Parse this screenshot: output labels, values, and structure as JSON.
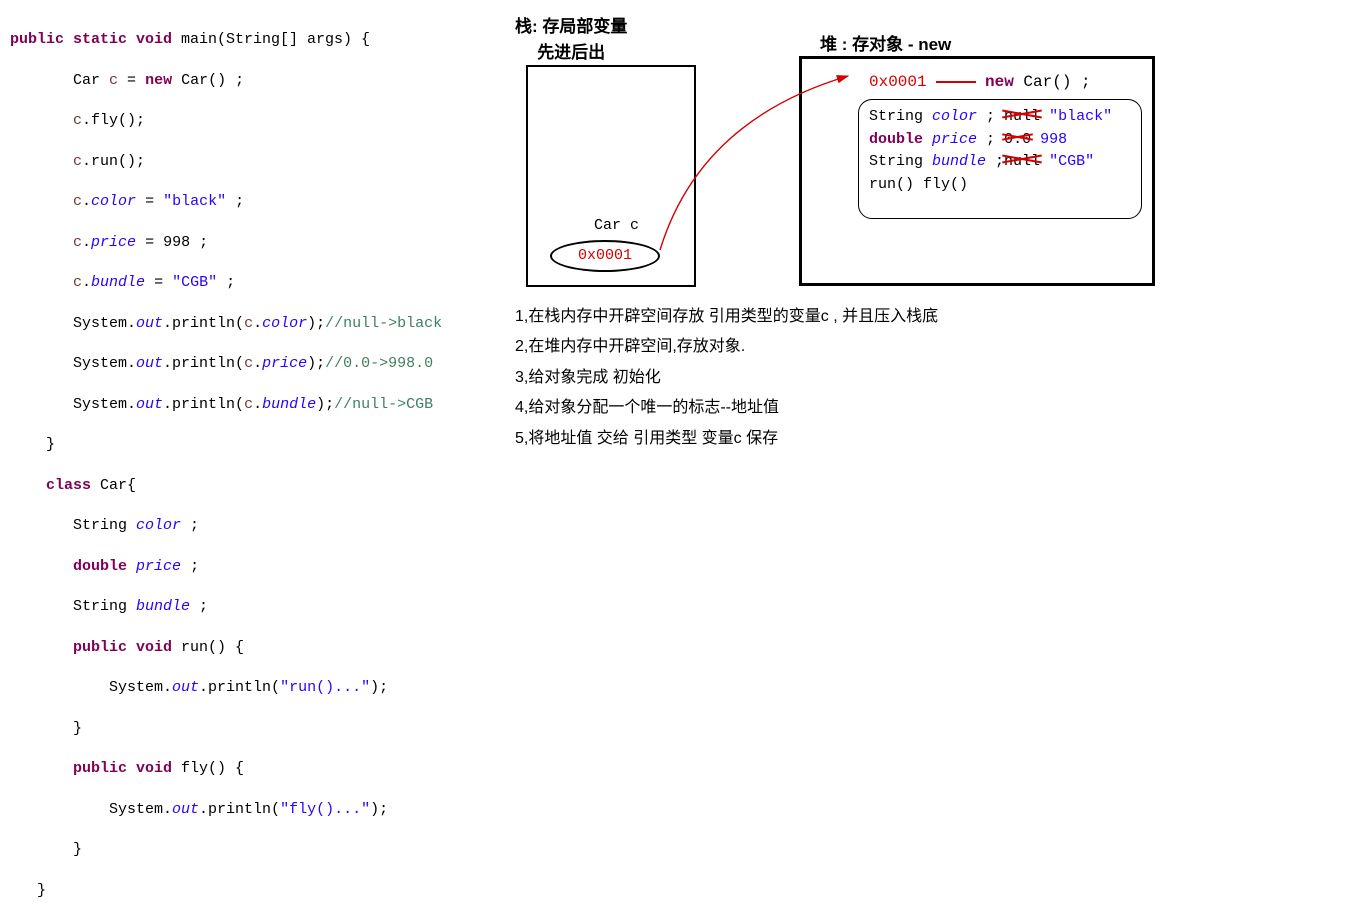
{
  "code": {
    "l1_1": "public static void ",
    "l1_2": "main(String[] args) {",
    "l2_1": "       Car ",
    "l2_2": "c",
    "l2_3": " = ",
    "l2_4": "new",
    "l2_5": " Car() ;",
    "l3_1": "       ",
    "l3_2": "c",
    "l3_3": ".fly();",
    "l4_1": "       ",
    "l4_2": "c",
    "l4_3": ".run();",
    "l5_1": "       ",
    "l5_2": "c",
    "l5_3": ".",
    "l5_4": "color",
    "l5_5": " = ",
    "l5_6": "\"black\"",
    "l5_7": " ;",
    "l6_1": "       ",
    "l6_2": "c",
    "l6_3": ".",
    "l6_4": "price",
    "l6_5": " = 998 ;",
    "l7_1": "       ",
    "l7_2": "c",
    "l7_3": ".",
    "l7_4": "bundle",
    "l7_5": " = ",
    "l7_6": "\"CGB\"",
    "l7_7": " ;",
    "l8_1": "       System.",
    "l8_2": "out",
    "l8_3": ".println(",
    "l8_4": "c",
    "l8_5": ".",
    "l8_6": "color",
    "l8_7": ");",
    "l8_8": "//null->black",
    "l9_1": "       System.",
    "l9_2": "out",
    "l9_3": ".println(",
    "l9_4": "c",
    "l9_5": ".",
    "l9_6": "price",
    "l9_7": ");",
    "l9_8": "//0.0->998.0",
    "l10_1": "       System.",
    "l10_2": "out",
    "l10_3": ".println(",
    "l10_4": "c",
    "l10_5": ".",
    "l10_6": "bundle",
    "l10_7": ");",
    "l10_8": "//null->CGB",
    "l11": "    }",
    "l12_1": "    ",
    "l12_2": "class",
    "l12_3": " Car{",
    "l13_1": "       String ",
    "l13_2": "color",
    "l13_3": " ;",
    "l14_1": "       ",
    "l14_2": "double",
    "l14_3": " ",
    "l14_4": "price",
    "l14_5": " ;",
    "l15_1": "       String ",
    "l15_2": "bundle",
    "l15_3": " ;",
    "l16_1": "       ",
    "l16_2": "public void",
    "l16_3": " run() {",
    "l17_1": "           System.",
    "l17_2": "out",
    "l17_3": ".println(",
    "l17_4": "\"run()...\"",
    "l17_5": ");",
    "l18": "       }",
    "l19_1": "       ",
    "l19_2": "public void",
    "l19_3": " fly() {",
    "l20_1": "           System.",
    "l20_2": "out",
    "l20_3": ".println(",
    "l20_4": "\"fly()...\"",
    "l20_5": ");",
    "l21": "       }",
    "l22": "   }"
  },
  "stack": {
    "title1": "栈: 存局部变量",
    "title2": "先进后出",
    "var_name": "Car c",
    "addr": "0x0001"
  },
  "heap": {
    "title": "堆 : 存对象 - new",
    "addr": "0x0001",
    "new_kw": "new",
    "new_expr": " Car() ;",
    "row1_pre": "String ",
    "row1_name": "color",
    "row1_sep": " ; ",
    "row1_old": "null",
    "row1_new": "\"black\"",
    "row2_pre_kw": "double",
    "row2_sp": " ",
    "row2_name": "price",
    "row2_sep": " ; ",
    "row2_old": "0.0",
    "row2_new": "998",
    "row3_pre": "String ",
    "row3_name": "bundle",
    "row3_sep": " ;",
    "row3_old": "null",
    "row3_new": "\"CGB\"",
    "row4": "run()   fly()"
  },
  "notes": {
    "n1": "1,在栈内存中开辟空间存放 引用类型的变量c , 并且压入栈底",
    "n2": "2,在堆内存中开辟空间,存放对象.",
    "n3": "3,给对象完成  初始化",
    "n4": "4,给对象分配一个唯一的标志--地址值",
    "n5": "5,将地址值  交给 引用类型 变量c 保存"
  }
}
